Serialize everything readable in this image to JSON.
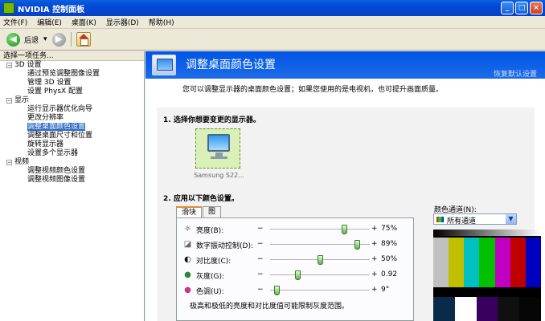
{
  "window": {
    "title": "NVIDIA 控制面板",
    "btn_min": "_",
    "btn_max": "□",
    "btn_close": "×"
  },
  "menu": [
    "文件(F)",
    "编辑(E)",
    "桌面(K)",
    "显示器(D)",
    "帮助(H)"
  ],
  "toolbar": {
    "back": "后退",
    "back_arrow": "◀",
    "fwd_arrow": "▶",
    "dropdown": "▾"
  },
  "sidebar": {
    "header": "选择一项任务...",
    "tree": [
      {
        "kind": "cat",
        "label": "3D 设置"
      },
      {
        "kind": "item",
        "label": "通过预览调整图像设置"
      },
      {
        "kind": "item",
        "label": "管理 3D 设置"
      },
      {
        "kind": "item",
        "label": "设置 PhysX 配置"
      },
      {
        "kind": "cat",
        "label": "显示"
      },
      {
        "kind": "item",
        "label": "运行显示器优化向导"
      },
      {
        "kind": "item",
        "label": "更改分辨率"
      },
      {
        "kind": "item",
        "label": "调整桌面颜色设置",
        "selected": true
      },
      {
        "kind": "item",
        "label": "调整桌面尺寸和位置"
      },
      {
        "kind": "item",
        "label": "旋转显示器"
      },
      {
        "kind": "item",
        "label": "设置多个显示器"
      },
      {
        "kind": "cat",
        "label": "视频"
      },
      {
        "kind": "item",
        "label": "调整视频颜色设置"
      },
      {
        "kind": "item",
        "label": "调整视频图像设置"
      }
    ]
  },
  "main": {
    "title": "调整桌面颜色设置",
    "restore": "恢复默认设置",
    "description": "您可以调整显示器的桌面颜色设置；如果您使用的是电视机，也可提升画面质量。",
    "step1": "1. 选择你想要变更的显示器。",
    "monitor_label": "Samsung S22...",
    "step2": "2. 应用以下颜色设置。",
    "tabs": [
      "滑块",
      "图"
    ],
    "sliders": [
      {
        "label": "亮度(B):",
        "value": "75%",
        "level": 0.75,
        "icon": "sun-icon",
        "glyph": "☼"
      },
      {
        "label": "数字振动控制(D):",
        "value": "89%",
        "level": 0.89,
        "icon": "vibrance-icon",
        "glyph": "◪"
      },
      {
        "label": "对比度(C):",
        "value": "50%",
        "level": 0.5,
        "icon": "contrast-icon",
        "glyph": "◐"
      },
      {
        "label": "灰度(G):",
        "value": "0.92",
        "level": 0.26,
        "icon": "gamma-icon",
        "glyph": "●"
      },
      {
        "label": "色调(U):",
        "value": "9°",
        "level": 0.04,
        "icon": "hue-icon",
        "glyph": "●"
      }
    ],
    "minus": "−",
    "plus": "+",
    "note": "极高和极低的亮度和对比度值可能限制灰度范围。",
    "channel_label": "颜色通道(N):",
    "channel_value": "所有通道",
    "bar_colors": [
      "#c0c0c0",
      "#c0c000",
      "#00c0c0",
      "#00c000",
      "#c000c0",
      "#c00000",
      "#0000c0"
    ],
    "low_colors": [
      "#0a2a4a",
      "#ffffff",
      "#3a0060",
      "#101010",
      "#050505"
    ]
  }
}
